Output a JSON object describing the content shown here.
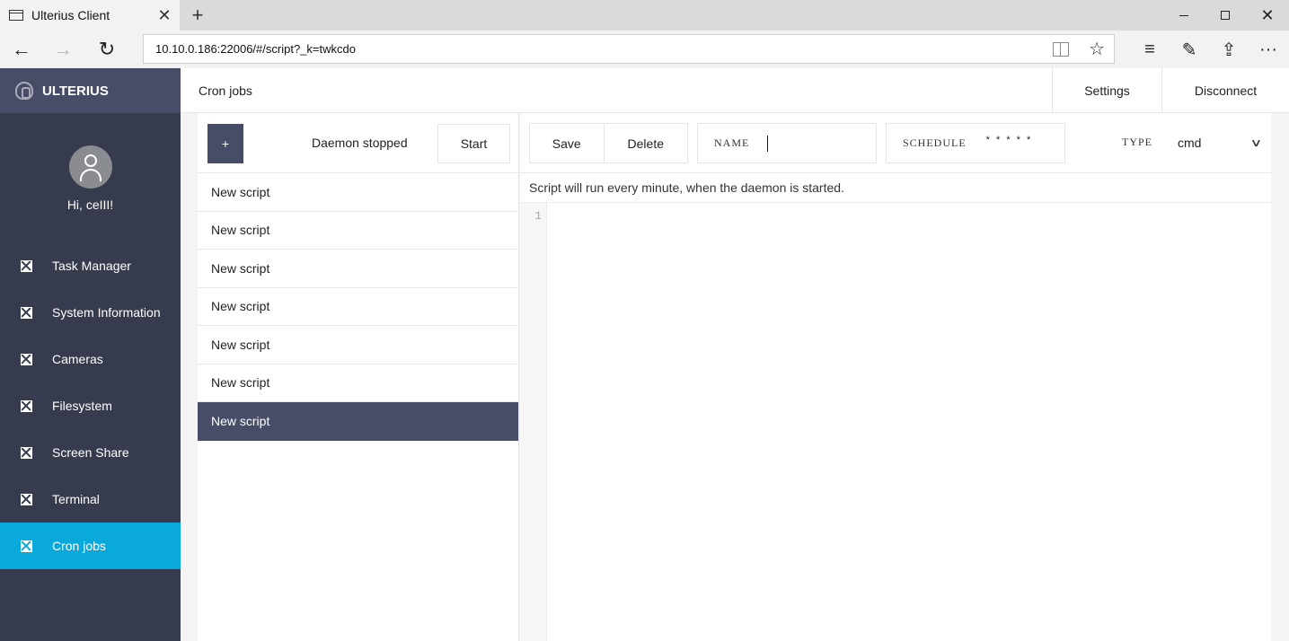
{
  "browser": {
    "tab_title": "Ulterius Client",
    "tab_close": "✕",
    "new_tab": "+",
    "url": "10.10.0.186:22006/#/script?_k=twkcdo",
    "back": "←",
    "forward": "→",
    "refresh": "↻",
    "window_close": "✕"
  },
  "sidebar": {
    "brand": "ULTERIUS",
    "greeting": "Hi, ceIII!",
    "items": [
      {
        "label": "Task Manager",
        "active": false
      },
      {
        "label": "System Information",
        "active": false
      },
      {
        "label": "Cameras",
        "active": false
      },
      {
        "label": "Filesystem",
        "active": false
      },
      {
        "label": "Screen Share",
        "active": false
      },
      {
        "label": "Terminal",
        "active": false
      },
      {
        "label": "Cron jobs",
        "active": true
      }
    ]
  },
  "topbar": {
    "title": "Cron jobs",
    "settings": "Settings",
    "disconnect": "Disconnect"
  },
  "scripts": {
    "add_label": "+",
    "daemon_status": "Daemon stopped",
    "start_label": "Start",
    "items": [
      "New script",
      "New script",
      "New script",
      "New script",
      "New script",
      "New script",
      "New script"
    ],
    "selected_index": 6
  },
  "editor": {
    "save_label": "Save",
    "delete_label": "Delete",
    "name_label": "NAME",
    "name_value": "",
    "schedule_label": "SCHEDULE",
    "schedule_value": "* * * * *",
    "type_label": "TYPE",
    "type_value": "cmd",
    "hint": "Script will run every minute, when the daemon is started.",
    "line_numbers": [
      "1"
    ]
  },
  "colors": {
    "sidebar_bg": "#363b4e",
    "brand_bg": "#474d66",
    "active_item": "#0aa9dc",
    "selected_script": "#474d66"
  }
}
